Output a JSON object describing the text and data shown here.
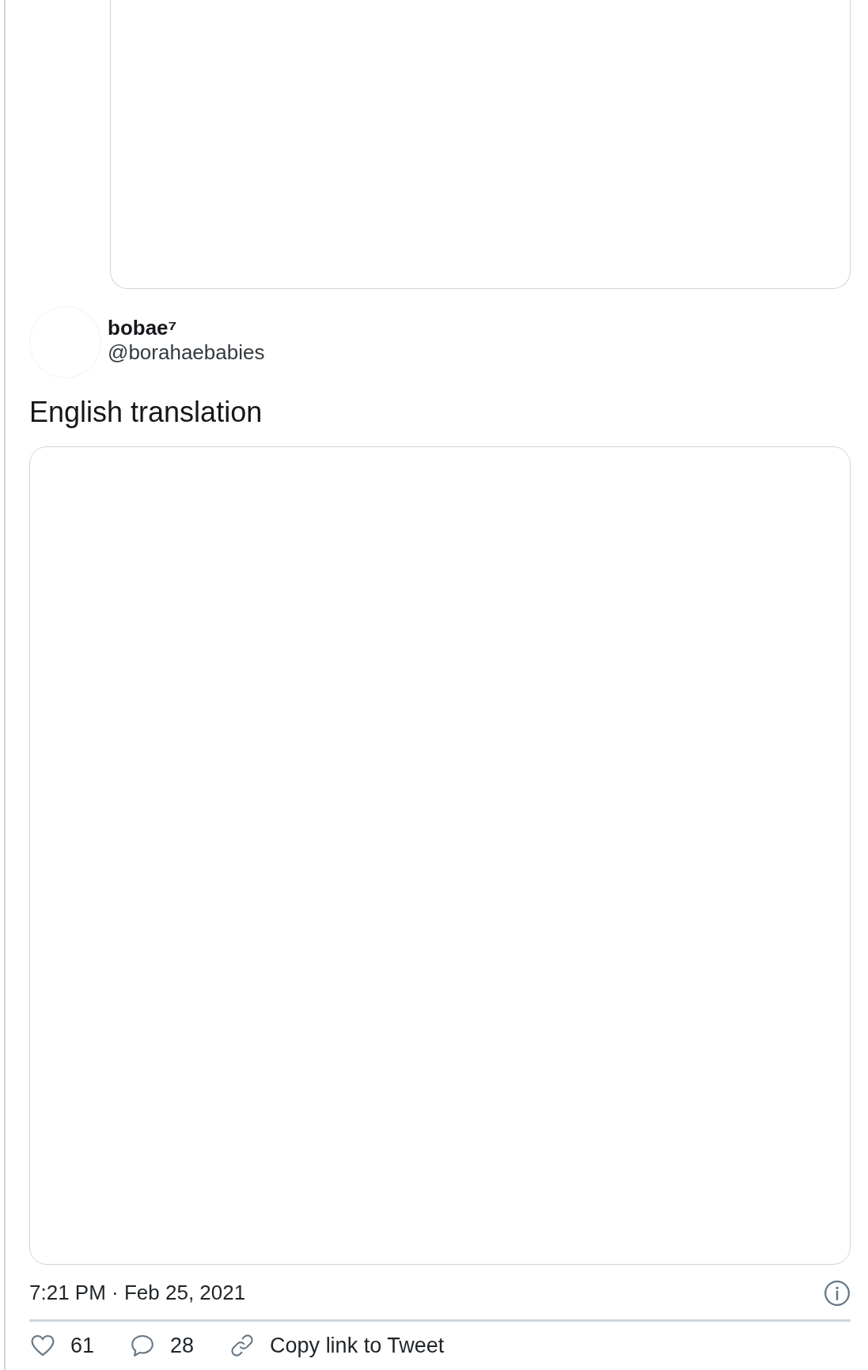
{
  "author": {
    "name": "bobae⁷",
    "handle": "@borahaebabies"
  },
  "text": "English translation",
  "timestamp": "7:21 PM · Feb 25, 2021",
  "actions": [
    {
      "kind": "like",
      "label": "61"
    },
    {
      "kind": "reply",
      "label": "28"
    },
    {
      "kind": "copy_link",
      "label": "Copy link to Tweet"
    }
  ]
}
